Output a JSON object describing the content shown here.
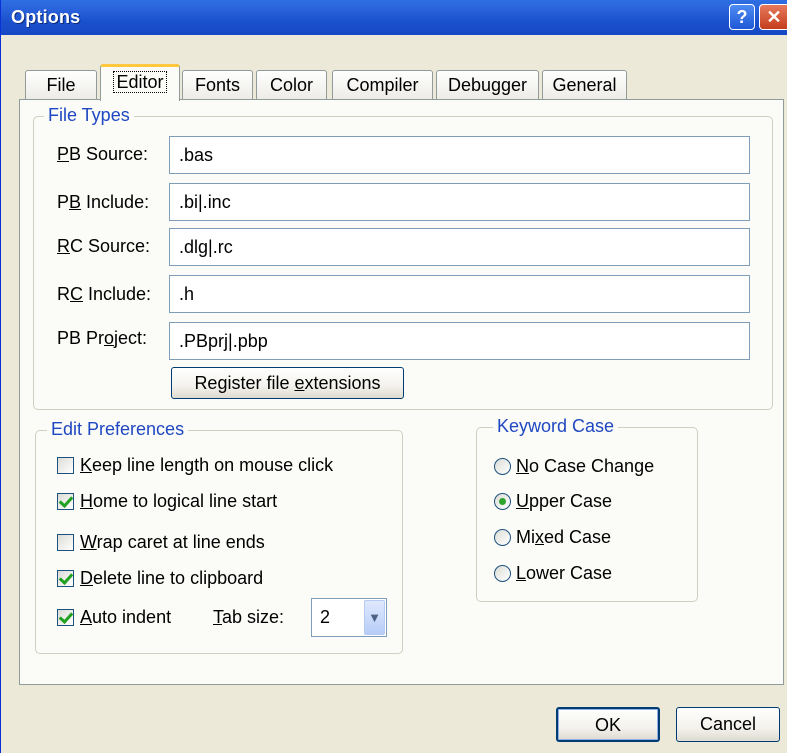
{
  "window": {
    "title": "Options"
  },
  "titlebar": {
    "help_glyph": "?",
    "close_glyph": "✕"
  },
  "tabs": [
    {
      "label": "File"
    },
    {
      "label": "Editor"
    },
    {
      "label": "Fonts"
    },
    {
      "label": "Color"
    },
    {
      "label": "Compiler"
    },
    {
      "label": "Debugger"
    },
    {
      "label": "General"
    }
  ],
  "active_tab": "Editor",
  "file_types": {
    "title": "File Types",
    "fields": [
      {
        "label_pre": "",
        "label_key": "P",
        "label_post": "B Source:",
        "value": ".bas"
      },
      {
        "label_pre": "P",
        "label_key": "B",
        "label_post": " Include:",
        "value": ".bi|.inc"
      },
      {
        "label_pre": "",
        "label_key": "R",
        "label_post": "C Source:",
        "value": ".dlg|.rc"
      },
      {
        "label_pre": "R",
        "label_key": "C",
        "label_post": " Include:",
        "value": ".h"
      },
      {
        "label_pre": "PB Pr",
        "label_key": "o",
        "label_post": "ject:",
        "value": ".PBprj|.pbp"
      }
    ],
    "register_button": {
      "pre": "Register file ",
      "key": "e",
      "post": "xtensions"
    }
  },
  "edit_preferences": {
    "title": "Edit Preferences",
    "options": [
      {
        "key": "K",
        "rest": "eep line length on mouse click",
        "checked": false
      },
      {
        "key": "H",
        "rest": "ome to logical line start",
        "checked": true
      },
      {
        "key": "W",
        "rest": "rap caret at line ends",
        "checked": false
      },
      {
        "key": "D",
        "rest": "elete line to clipboard",
        "checked": true
      },
      {
        "key": "A",
        "rest": "uto indent",
        "checked": true
      }
    ],
    "tab_size": {
      "label_key": "T",
      "label_rest": "ab size:",
      "value": "2"
    }
  },
  "keyword_case": {
    "title": "Keyword Case",
    "options": [
      {
        "pre": "",
        "key": "N",
        "post": "o Case Change",
        "selected": false
      },
      {
        "pre": "",
        "key": "U",
        "post": "pper Case",
        "selected": true
      },
      {
        "pre": "Mi",
        "key": "x",
        "post": "ed Case",
        "selected": false
      },
      {
        "pre": "",
        "key": "L",
        "post": "ower Case",
        "selected": false
      }
    ]
  },
  "footer": {
    "ok_label": "OK",
    "cancel_label": "Cancel"
  },
  "colors": {
    "title_bar": "#1b51cd",
    "group_title": "#1f48c2",
    "dialog_bg": "#ece9d8",
    "active_tab_accent": "#ffc83c"
  }
}
